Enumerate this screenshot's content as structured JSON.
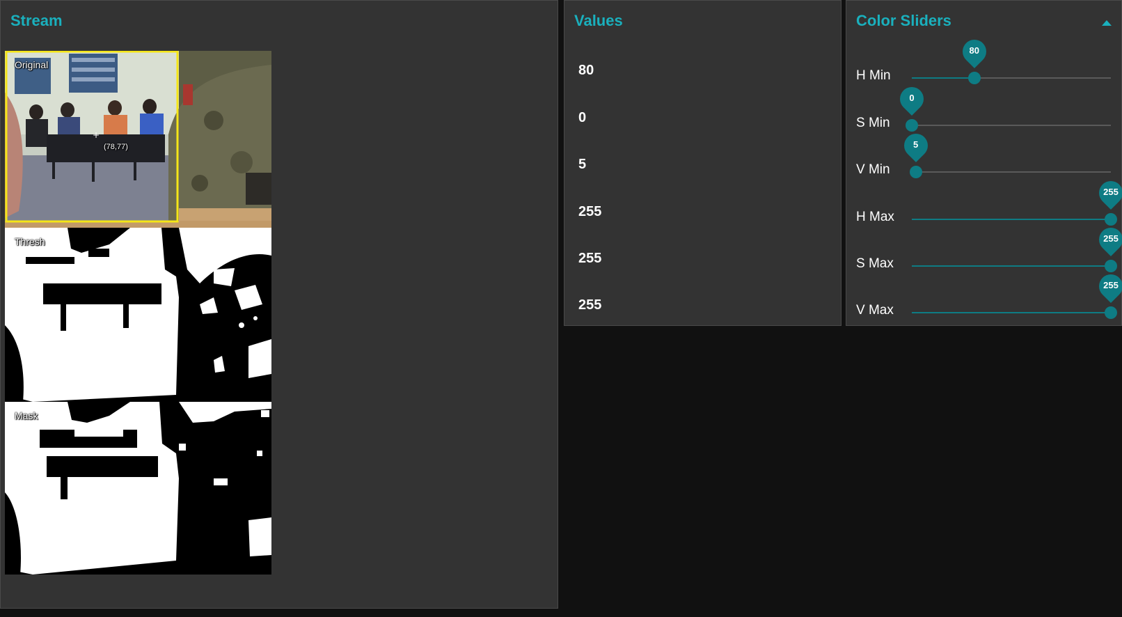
{
  "stream": {
    "title": "Stream",
    "images": {
      "original_label": "Original",
      "coord_readout": "(78,77)",
      "thresh_label": "Thresh",
      "mask_label": "Mask"
    }
  },
  "values": {
    "title": "Values",
    "items": [
      "80",
      "0",
      "5",
      "255",
      "255",
      "255"
    ]
  },
  "sliders": {
    "title": "Color Sliders",
    "collapse_icon": "chevron-up-icon",
    "min": 0,
    "max": 255,
    "accent_color": "#0e7c84",
    "items": [
      {
        "label": "H Min",
        "value": 80
      },
      {
        "label": "S Min",
        "value": 0
      },
      {
        "label": "V Min",
        "value": 5
      },
      {
        "label": "H Max",
        "value": 255
      },
      {
        "label": "S Max",
        "value": 255
      },
      {
        "label": "V Max",
        "value": 255
      }
    ]
  },
  "colors": {
    "title_accent": "#1ab0bd",
    "panel_bg": "#333333",
    "page_bg": "#111111",
    "roi_highlight": "#f5e617"
  }
}
